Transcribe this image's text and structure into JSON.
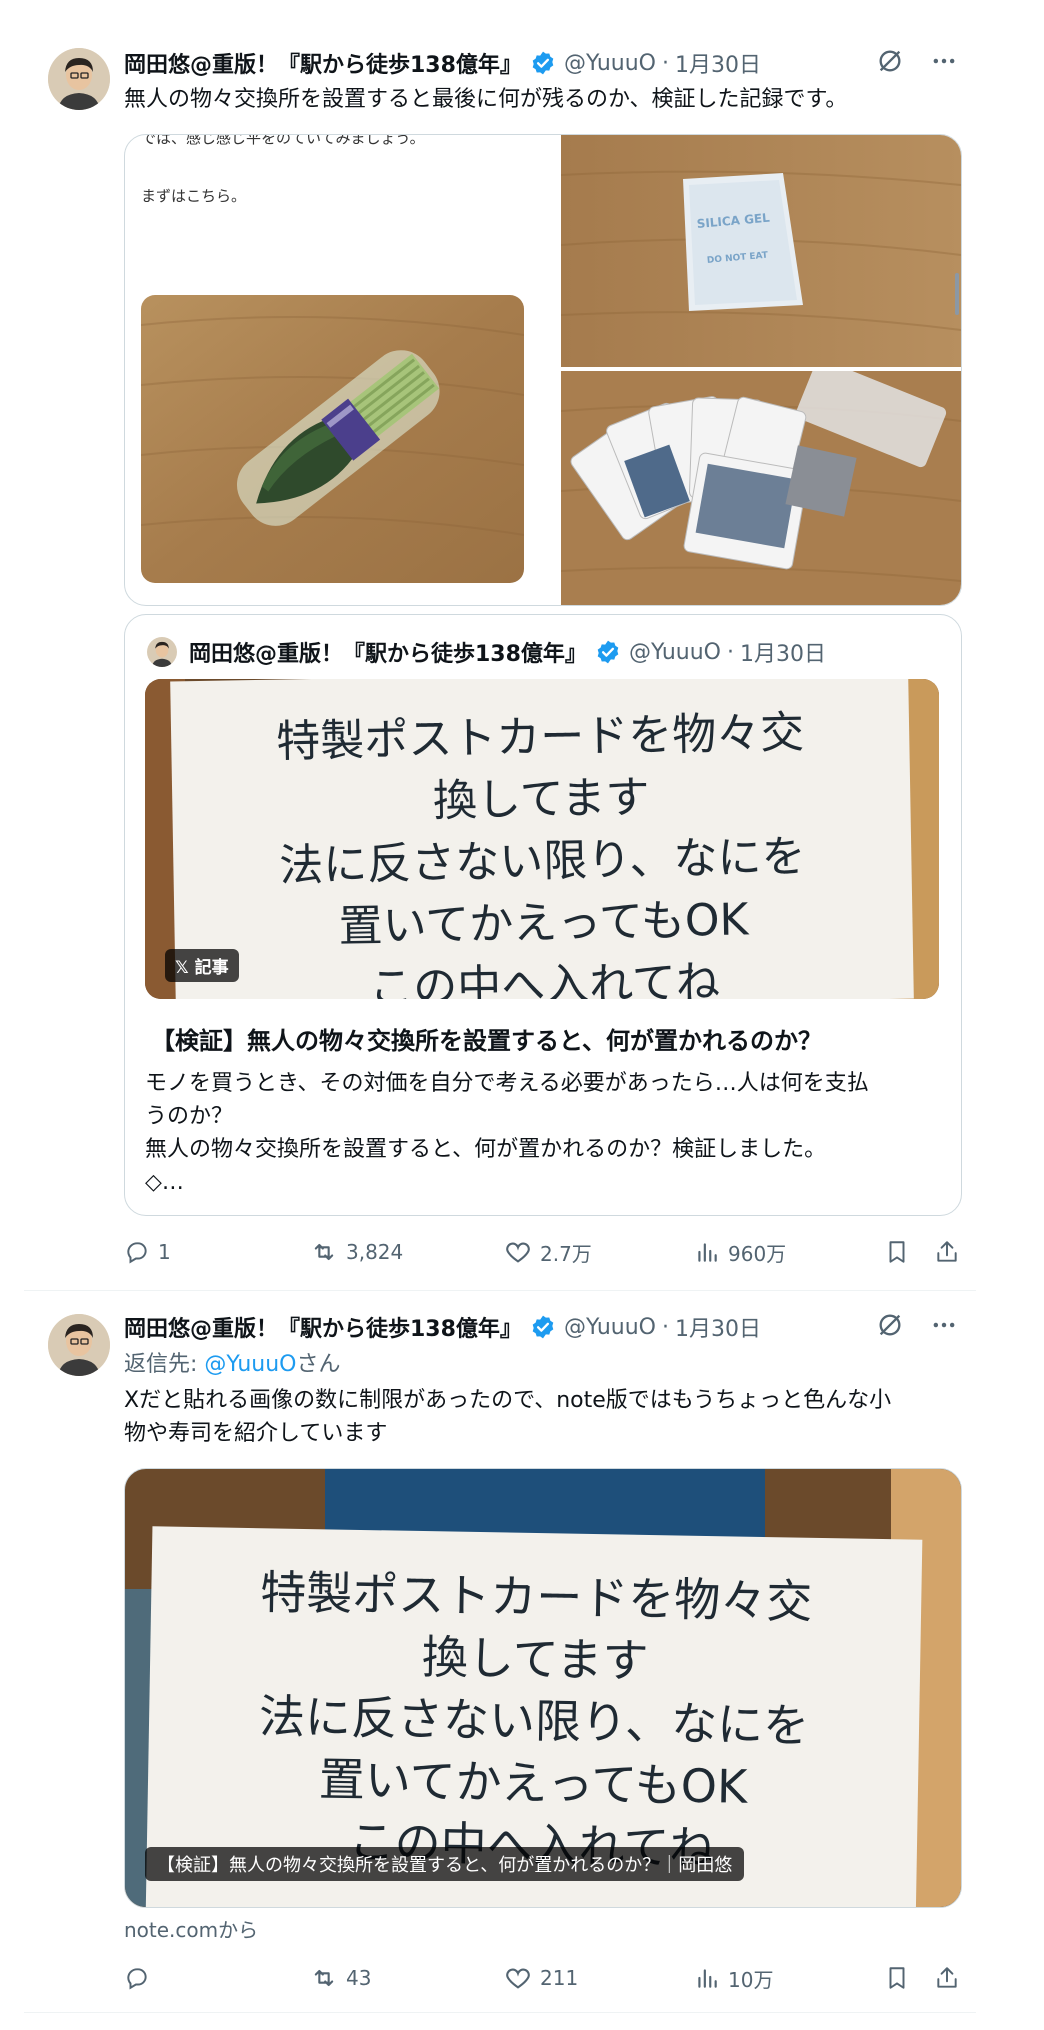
{
  "tweets": [
    {
      "author": "岡田悠@重版！『駅から徒歩138億年』",
      "handle": "@YuuuO",
      "date": "1月30日",
      "text": "無人の物々交換所を設置すると最後に何が残るのか、検証した記録です。",
      "article_preview": {
        "top_text": "では、感じ感じ平をのていてみましょう。",
        "intro": "まずはこちら。"
      },
      "quoted": {
        "author": "岡田悠@重版！『駅から徒歩138億年』",
        "handle": "@YuuuO",
        "date": "1月30日",
        "badge": "𝕏 記事",
        "sign_lines": [
          "特製ポストカードを物々交",
          "換してます",
          "法に反さない限り、なにを",
          "置いてかえってもOK",
          "この中へ入れてね"
        ],
        "title": "【検証】無人の物々交換所を設置すると、何が置かれるのか？",
        "excerpt_lines": [
          "モノを買うとき、その対価を自分で考える必要があったら…人は何を支払",
          "うのか？",
          "無人の物々交換所を設置すると、何が置かれるのか？検証しました。",
          "◇…"
        ]
      },
      "stats": {
        "replies": "1",
        "reposts": "3,824",
        "likes": "2.7万",
        "views": "960万"
      }
    },
    {
      "author": "岡田悠@重版！『駅から徒歩138億年』",
      "handle": "@YuuuO",
      "date": "1月30日",
      "reply_prefix": "返信先: ",
      "reply_handle": "@YuuuO",
      "reply_suffix": "さん",
      "text_lines": [
        "Xだと貼れる画像の数に制限があったので、note版ではもうちょっと色んな小",
        "物や寿司を紹介しています"
      ],
      "link_card": {
        "sign_lines": [
          "特製ポストカードを物々交",
          "換してます",
          "法に反さない限り、なにを",
          "置いてかえってもOK",
          "この中へ入れてね"
        ],
        "caption": "【検証】無人の物々交換所を設置すると、何が置かれるのか？｜岡田悠",
        "source": "note.comから"
      },
      "stats": {
        "replies": "",
        "reposts": "43",
        "likes": "211",
        "views": "10万"
      }
    }
  ],
  "colors": {
    "accent": "#1d9bf0",
    "muted": "#536471",
    "border": "#cfd9de"
  }
}
